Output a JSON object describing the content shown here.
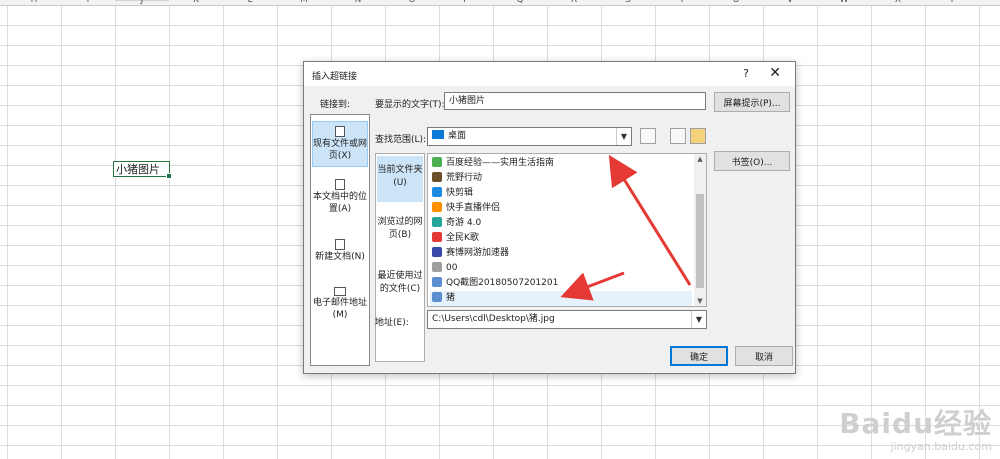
{
  "sheet": {
    "columns": [
      "H",
      "I",
      "J",
      "K",
      "L",
      "M",
      "N",
      "O",
      "P",
      "Q",
      "R",
      "S",
      "T",
      "U",
      "V",
      "W",
      "X",
      "Y"
    ],
    "active_cell_text": "小猪图片"
  },
  "dialog": {
    "title": "插入超链接",
    "help": "?",
    "close": "✕",
    "link_to_label": "链接到:",
    "link_to_items": [
      "现有文件或网页(X)",
      "本文档中的位置(A)",
      "新建文档(N)",
      "电子邮件地址(M)"
    ],
    "display_text_label": "要显示的文字(T):",
    "display_text_value": "小猪图片",
    "screentip_button": "屏幕提示(P)...",
    "lookin_label": "查找范围(L):",
    "lookin_value": "桌面",
    "bookmark_button": "书签(O)...",
    "subtabs": [
      "当前文件夹(U)",
      "浏览过的网页(B)",
      "最近使用过的文件(C)"
    ],
    "files": [
      {
        "name": "百度经验——实用生活指南",
        "icon": "web-shortcut-icon",
        "color": "#4caf50"
      },
      {
        "name": "荒野行动",
        "icon": "game-icon",
        "color": "#6b4f2a"
      },
      {
        "name": "快剪辑",
        "icon": "video-editor-icon",
        "color": "#1e88e5"
      },
      {
        "name": "快手直播伴侣",
        "icon": "live-icon",
        "color": "#ff8f00"
      },
      {
        "name": "奇游 4.0",
        "icon": "app-icon",
        "color": "#26a69a"
      },
      {
        "name": "全民K歌",
        "icon": "karaoke-icon",
        "color": "#e53935"
      },
      {
        "name": "赛博网游加速器",
        "icon": "accelerator-icon",
        "color": "#3949ab"
      },
      {
        "name": "00",
        "icon": "file-icon",
        "color": "#9e9e9e"
      },
      {
        "name": "QQ截图20180507201201",
        "icon": "image-file-icon",
        "color": "#5c8ecf"
      },
      {
        "name": "猪",
        "icon": "image-file-icon",
        "color": "#5c8ecf"
      }
    ],
    "selected_file_index": 9,
    "address_label": "地址(E):",
    "address_value": "C:\\Users\\cdl\\Desktop\\猪.jpg",
    "ok_button": "确定",
    "cancel_button": "取消"
  },
  "watermark": {
    "logo": "Baidu经验",
    "sub": "jingyan.baidu.com"
  },
  "colors": {
    "accent": "#0078d7",
    "excel_green": "#217346",
    "arrow_red": "#e53935",
    "selection": "#cce4f7"
  }
}
